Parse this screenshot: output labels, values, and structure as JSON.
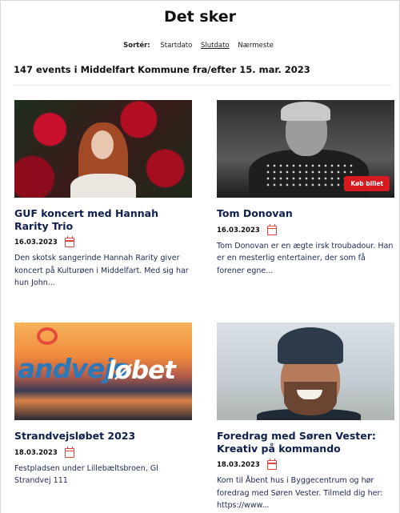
{
  "page": {
    "title": "Det sker",
    "sort": {
      "label": "Sortér:",
      "options": [
        "Startdato",
        "Slutdato",
        "Nærmeste"
      ],
      "active": "Slutdato"
    },
    "result_heading": "147 events i Middelfart Kommune fra/efter 15. mar. 2023"
  },
  "events": [
    {
      "title": "GUF koncert med Hannah Rarity Trio",
      "date": "16.03.2023",
      "description": "Den skotsk sangerinde Hannah Rarity giver koncert på Kulturøen i Middelfart. Med sig har hun John..."
    },
    {
      "title": "Tom Donovan",
      "date": "16.03.2023",
      "description": "Tom Donovan er en ægte irsk troubadour. Han er en mesterlig entertainer, der som få forener egne...",
      "badge": "Køb billet"
    },
    {
      "title": "Strandvejsløbet 2023",
      "date": "18.03.2023",
      "description": "Festpladsen under Lillebæltsbroen, Gl Strandvej 111",
      "logo_text": "Strandvejsløbet"
    },
    {
      "title": "Foredrag med Søren Vester: Kreativ på kommando",
      "date": "18.03.2023",
      "description": "Kom til Åbent hus i Byggecentrum og hør foredrag med Søren Vester. Tilmeld dig her: https://www..."
    }
  ],
  "colors": {
    "title_navy": "#0e1f4f",
    "accent_red": "#e0443f",
    "button_red": "#d71920"
  },
  "icons": [
    "calendar-icon"
  ]
}
